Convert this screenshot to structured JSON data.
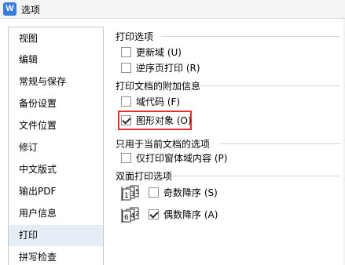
{
  "window": {
    "app_icon": "W",
    "title": "选项"
  },
  "sidebar": {
    "items": [
      {
        "label": "视图"
      },
      {
        "label": "编辑"
      },
      {
        "label": "常规与保存"
      },
      {
        "label": "备份设置"
      },
      {
        "label": "文件位置"
      },
      {
        "label": "修订"
      },
      {
        "label": "中文版式"
      },
      {
        "label": "输出PDF"
      },
      {
        "label": "用户信息"
      },
      {
        "label": "打印",
        "selected": true
      },
      {
        "label": "拼写检查"
      }
    ]
  },
  "print_options": {
    "title": "打印选项",
    "update_fields": {
      "label": "更新域 (U)",
      "checked": false
    },
    "reverse_order": {
      "label": "逆序页打印 (R)",
      "checked": false
    }
  },
  "attachments": {
    "title": "打印文档的附加信息",
    "field_codes": {
      "label": "域代码 (F)",
      "checked": false
    },
    "drawing_objects": {
      "label": "图形对象 (O)",
      "checked": true
    }
  },
  "current_doc": {
    "title": "只用于当前文档的选项",
    "form_data_only": {
      "label": "仅打印窗体域内容 (P)",
      "checked": false
    }
  },
  "duplex": {
    "title": "双面打印选项",
    "odd_reverse": {
      "label": "奇数降序 (S)",
      "checked": false
    },
    "even_reverse": {
      "label": "偶数降序 (A)",
      "checked": true
    }
  }
}
